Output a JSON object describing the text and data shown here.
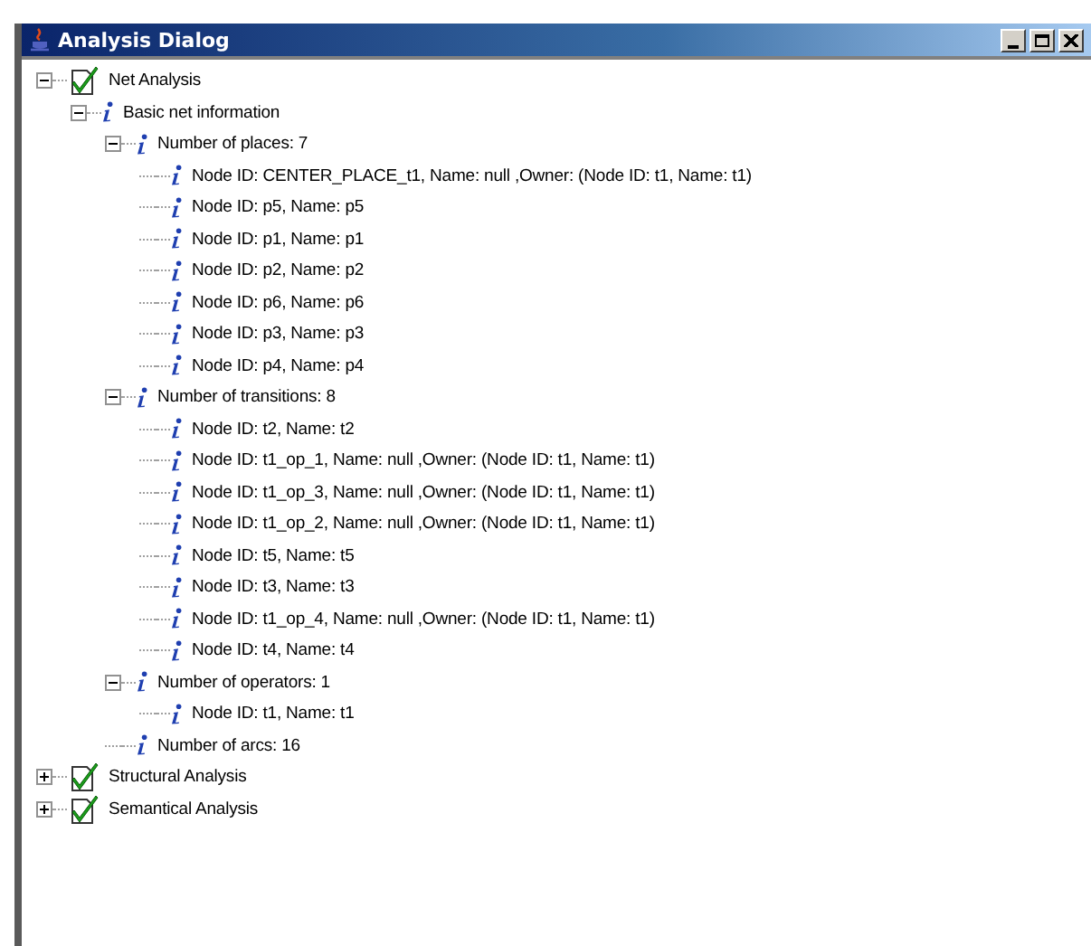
{
  "window": {
    "title": "Analysis Dialog"
  },
  "tree": [
    {
      "kind": "check",
      "label": "Net Analysis",
      "expanded": true,
      "children": [
        {
          "kind": "info",
          "label": "Basic net information",
          "expanded": true,
          "children": [
            {
              "kind": "info",
              "label": "Number of places: 7",
              "expanded": true,
              "children": [
                {
                  "kind": "info",
                  "label": "Node ID: CENTER_PLACE_t1, Name: null ,Owner: (Node ID: t1, Name: t1)"
                },
                {
                  "kind": "info",
                  "label": "Node ID: p5, Name: p5"
                },
                {
                  "kind": "info",
                  "label": "Node ID: p1, Name: p1"
                },
                {
                  "kind": "info",
                  "label": "Node ID: p2, Name: p2"
                },
                {
                  "kind": "info",
                  "label": "Node ID: p6, Name: p6"
                },
                {
                  "kind": "info",
                  "label": "Node ID: p3, Name: p3"
                },
                {
                  "kind": "info",
                  "label": "Node ID: p4, Name: p4"
                }
              ]
            },
            {
              "kind": "info",
              "label": "Number of transitions: 8",
              "expanded": true,
              "children": [
                {
                  "kind": "info",
                  "label": "Node ID: t2, Name: t2"
                },
                {
                  "kind": "info",
                  "label": "Node ID: t1_op_1, Name: null ,Owner: (Node ID: t1, Name: t1)"
                },
                {
                  "kind": "info",
                  "label": "Node ID: t1_op_3, Name: null ,Owner: (Node ID: t1, Name: t1)"
                },
                {
                  "kind": "info",
                  "label": "Node ID: t1_op_2, Name: null ,Owner: (Node ID: t1, Name: t1)"
                },
                {
                  "kind": "info",
                  "label": "Node ID: t5, Name: t5"
                },
                {
                  "kind": "info",
                  "label": "Node ID: t3, Name: t3"
                },
                {
                  "kind": "info",
                  "label": "Node ID: t1_op_4, Name: null ,Owner: (Node ID: t1, Name: t1)"
                },
                {
                  "kind": "info",
                  "label": "Node ID: t4, Name: t4"
                }
              ]
            },
            {
              "kind": "info",
              "label": "Number of operators: 1",
              "expanded": true,
              "children": [
                {
                  "kind": "info",
                  "label": "Node ID: t1, Name: t1"
                }
              ]
            },
            {
              "kind": "info",
              "label": "Number of arcs: 16"
            }
          ]
        }
      ]
    },
    {
      "kind": "check",
      "label": "Structural Analysis",
      "expanded": false
    },
    {
      "kind": "check",
      "label": "Semantical Analysis",
      "expanded": false
    }
  ]
}
